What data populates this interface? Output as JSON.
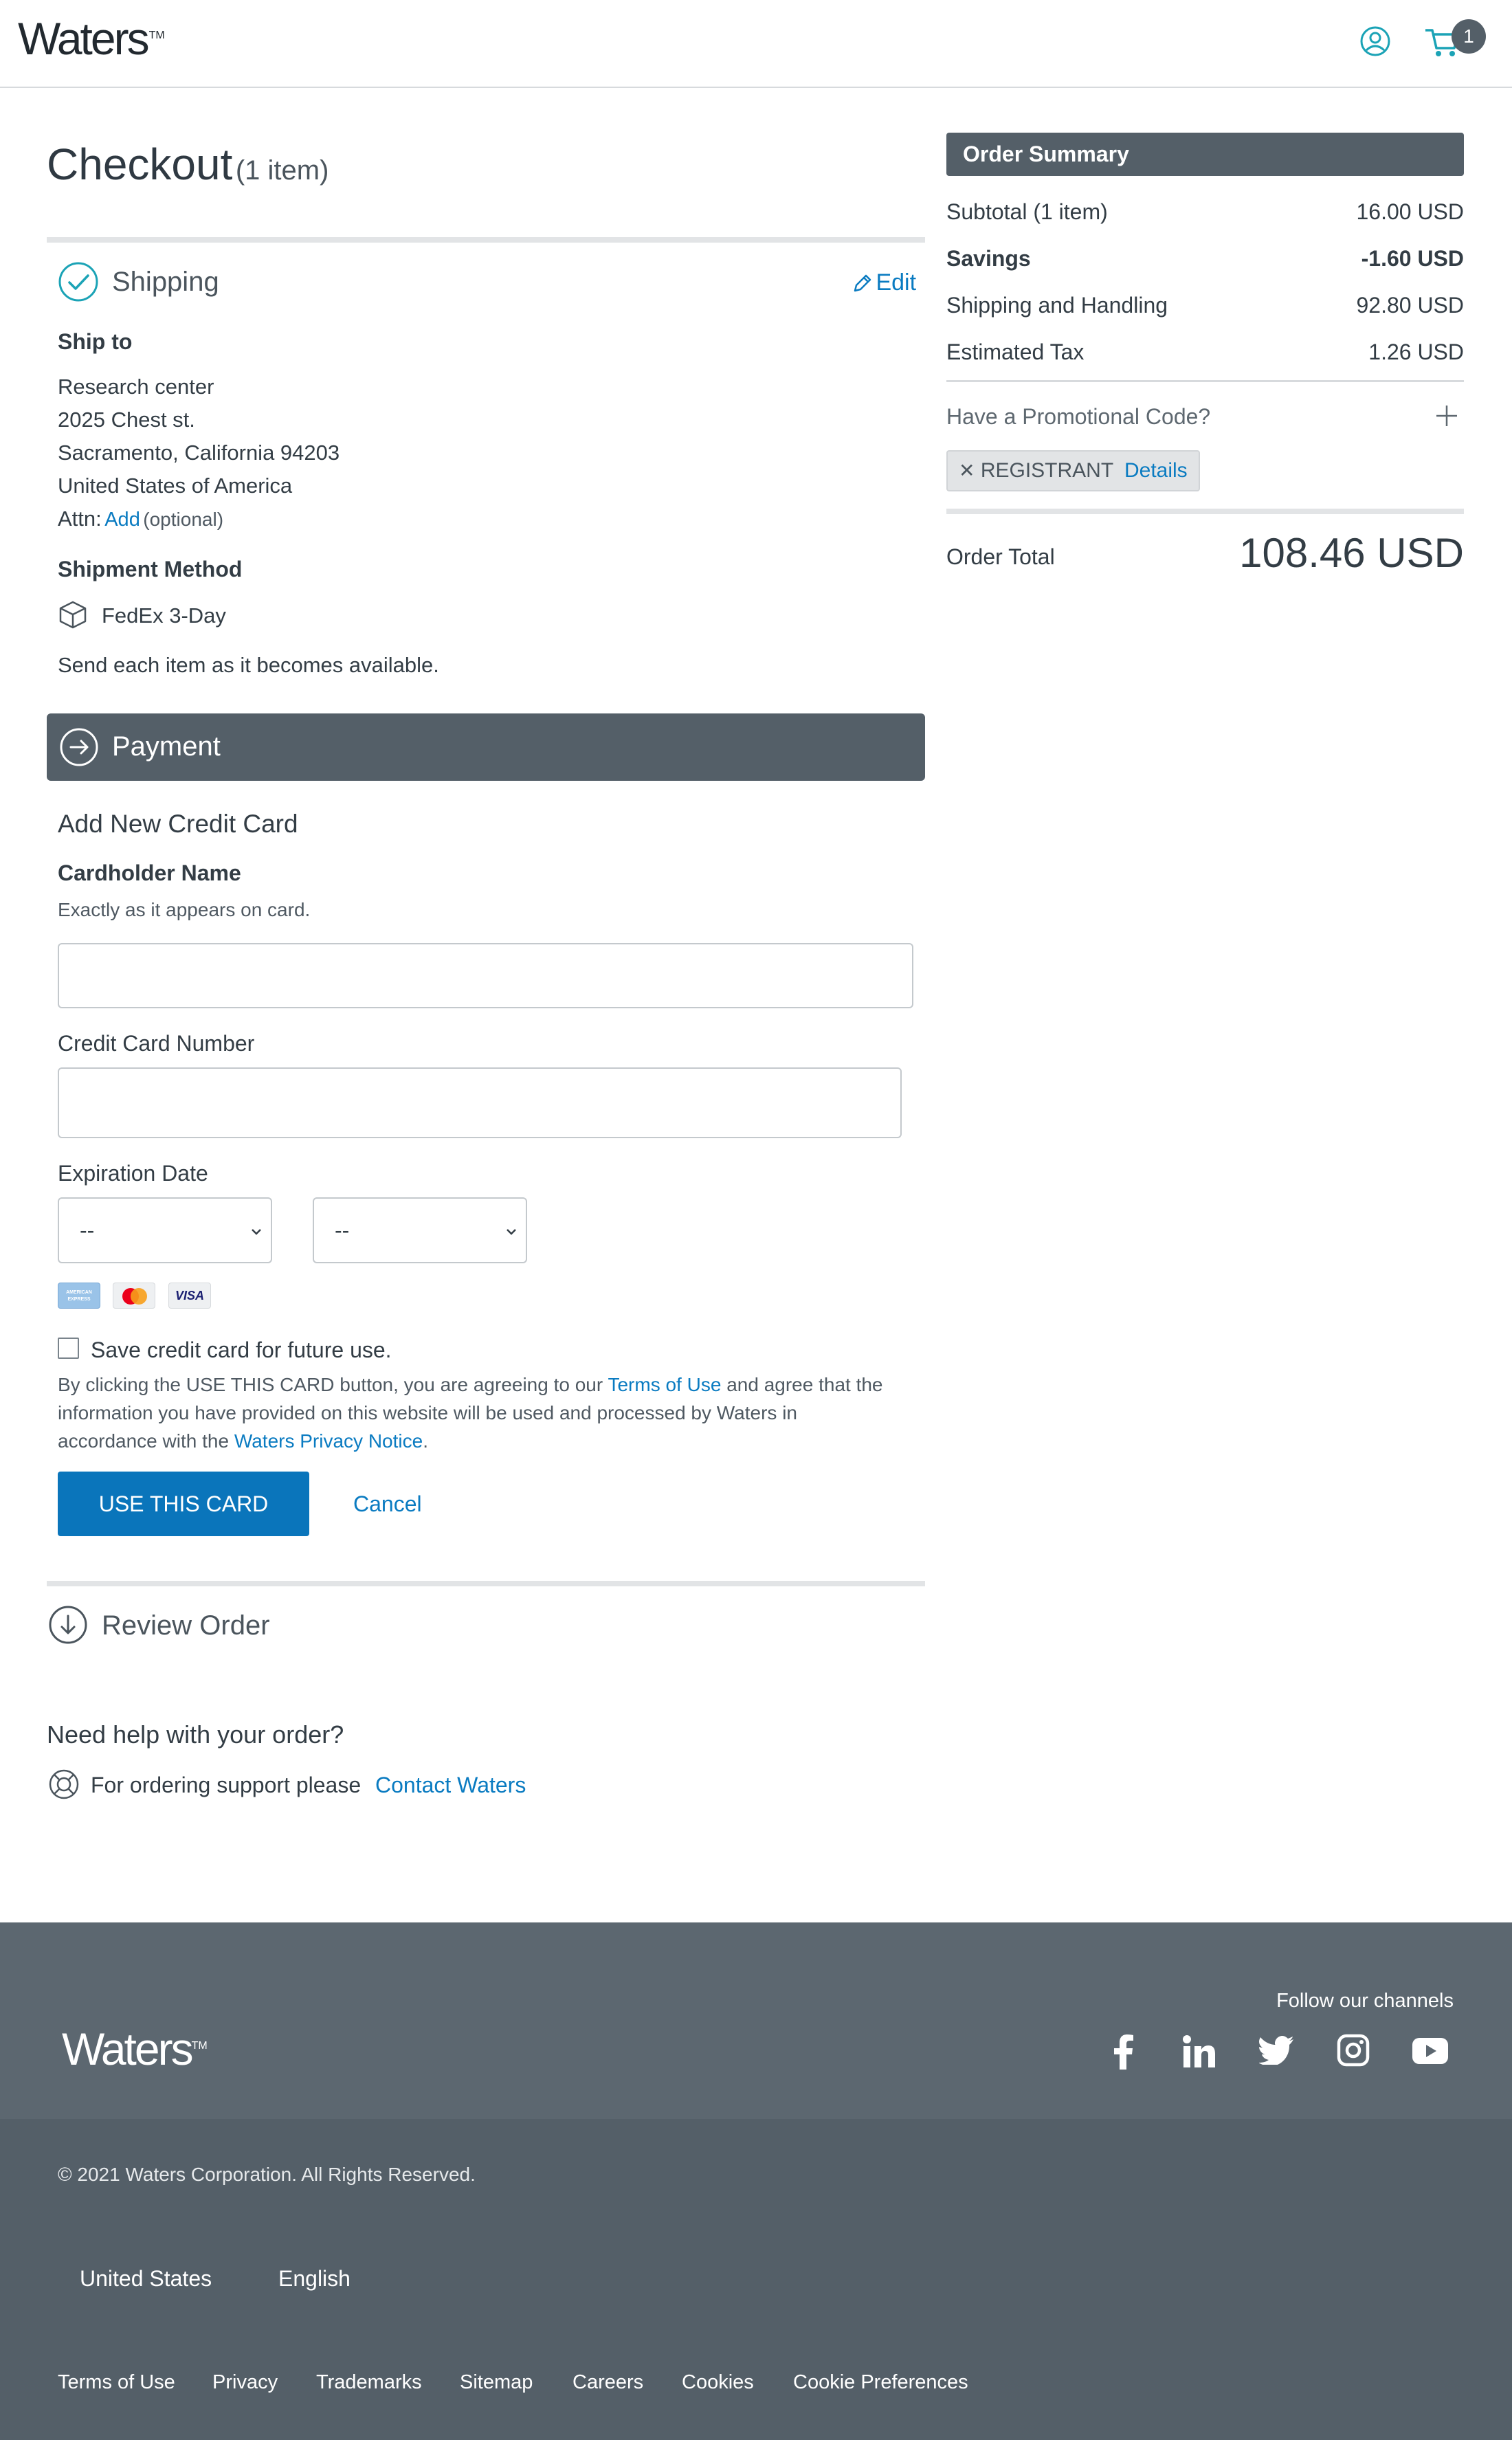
{
  "header": {
    "logo": "Waters",
    "logo_tm": "TM",
    "cart_count": "1",
    "brand_color": "#1ba3b6"
  },
  "checkout": {
    "title": "Checkout",
    "item_count": "(1 item)"
  },
  "shipping": {
    "title": "Shipping",
    "edit_label": "Edit",
    "ship_to_label": "Ship to",
    "address_lines": [
      "Research center",
      "2025 Chest st.",
      "Sacramento, California 94203",
      "United States of America"
    ],
    "attn_label": "Attn:",
    "attn_add": "Add",
    "attn_optional": "(optional)",
    "method_label": "Shipment Method",
    "method_value": "FedEx 3-Day",
    "send_note": "Send each item as it becomes available."
  },
  "payment": {
    "title": "Payment",
    "add_card_title": "Add New Credit Card",
    "cardholder_label": "Cardholder Name",
    "cardholder_hint": "Exactly as it appears on card.",
    "cardholder_value": "",
    "card_number_label": "Credit Card Number",
    "card_number_value": "",
    "expiration_label": "Expiration Date",
    "month_selected": "--",
    "year_selected": "--",
    "card_types": [
      "AMERICAN EXPRESS",
      "mastercard",
      "VISA"
    ],
    "save_card_label": "Save credit card for future use.",
    "agreement_part1": "By clicking the USE THIS CARD button, you are agreeing to our",
    "terms_link": "Terms of Use",
    "agreement_part2": "and agree that the",
    "agreement_line2": "information you have provided on this website will be used and processed by Waters in",
    "agreement_line3_prefix": "accordance with the",
    "privacy_link": "Waters Privacy Notice",
    "agreement_line3_suffix": ".",
    "use_card_button": "USE THIS CARD",
    "cancel_button": "Cancel"
  },
  "review": {
    "title": "Review Order"
  },
  "help": {
    "title": "Need help with your order?",
    "text": "For ordering support please",
    "link": "Contact Waters"
  },
  "order_summary": {
    "title": "Order Summary",
    "rows": [
      {
        "label": "Subtotal (1 item)",
        "value": "16.00 USD"
      },
      {
        "label": "Savings",
        "value": "-1.60 USD"
      },
      {
        "label": "Shipping and Handling",
        "value": "92.80 USD"
      },
      {
        "label": "Estimated Tax",
        "value": "1.26 USD"
      }
    ],
    "promo_label": "Have a Promotional Code?",
    "promo_chip_code": "REGISTRANT",
    "promo_chip_details": "Details",
    "total_label": "Order Total",
    "total_value": "108.46 USD"
  },
  "footer": {
    "logo": "Waters",
    "follow_label": "Follow our channels",
    "social": [
      "facebook-icon",
      "linkedin-icon",
      "twitter-icon",
      "instagram-icon",
      "youtube-icon"
    ],
    "copyright": "© 2021 Waters Corporation. All Rights Reserved.",
    "country": "United States",
    "language": "English",
    "links": [
      "Terms of Use",
      "Privacy",
      "Trademarks",
      "Sitemap",
      "Careers",
      "Cookies",
      "Cookie Preferences"
    ]
  }
}
